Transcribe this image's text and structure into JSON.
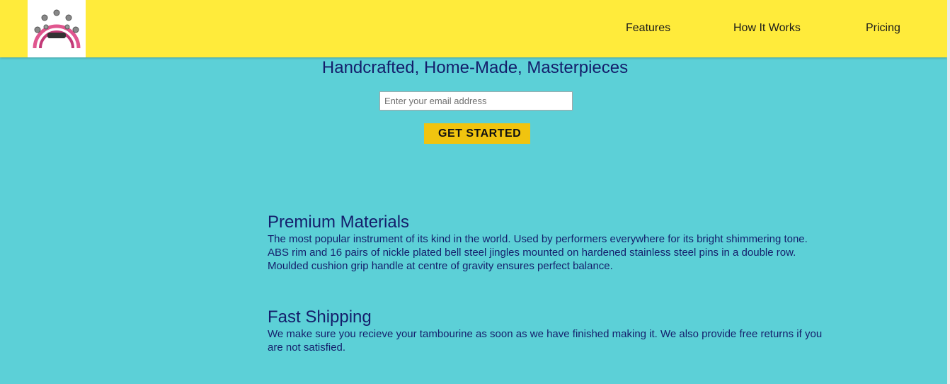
{
  "colors": {
    "header_bg": "#ffeb3b",
    "page_bg": "#5cd0d7",
    "heading_text": "#141e6b",
    "button_bg": "#f1c40f"
  },
  "header": {
    "logo_icon": "tambourine-icon",
    "nav": [
      {
        "label": "Features"
      },
      {
        "label": "How It Works"
      },
      {
        "label": "Pricing"
      }
    ]
  },
  "hero": {
    "title": "Handcrafted, Home-Made, Masterpieces",
    "email_placeholder": "Enter your email address",
    "button_label": "GET STARTED"
  },
  "features": [
    {
      "title": "Premium Materials",
      "text": "The most popular instrument of its kind in the world. Used by performers everywhere for its bright shimmering tone. ABS rim and 16 pairs of nickle plated bell steel jingles mounted on hardened stainless steel pins in a double row. Moulded cushion grip handle at centre of gravity ensures perfect balance."
    },
    {
      "title": "Fast Shipping",
      "text": "We make sure you recieve your tambourine as soon as we have finished making it. We also provide free returns if you are not satisfied."
    }
  ]
}
